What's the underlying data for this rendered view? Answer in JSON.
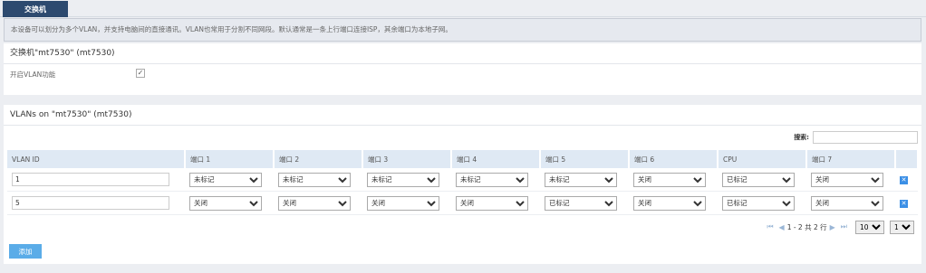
{
  "tab": {
    "label": "交换机"
  },
  "info_text": "本设备可以划分为多个VLAN，并支持电脑间的直接通讯。VLAN也常用于分割不同网段。默认通常是一条上行端口连接ISP，其余端口为本地子网。",
  "switch_section": {
    "title": "交换机\"mt7530\" (mt7530)",
    "enable_vlan_label": "开启VLAN功能",
    "enable_vlan_checked": true,
    "check_glyph": "✓"
  },
  "vlans_section": {
    "title": "VLANs on \"mt7530\" (mt7530)",
    "search_label": "搜索:",
    "search_value": "",
    "columns": [
      "VLAN ID",
      "端口 1",
      "端口 2",
      "端口 3",
      "端口 4",
      "端口 5",
      "端口 6",
      "CPU",
      "端口 7"
    ],
    "rows": [
      {
        "vlan_id": "1",
        "ports": [
          "未标记",
          "未标记",
          "未标记",
          "未标记",
          "未标记",
          "关闭",
          "已标记",
          "关闭"
        ]
      },
      {
        "vlan_id": "5",
        "ports": [
          "关闭",
          "关闭",
          "关闭",
          "关闭",
          "已标记",
          "关闭",
          "已标记",
          "关闭"
        ]
      }
    ],
    "delete_glyph": "✕"
  },
  "pager": {
    "first_icon": "⏮",
    "prev_icon": "◀",
    "range_text": "1 - 2 共 2 行",
    "next_icon": "▶",
    "last_icon": "⏭",
    "page_size": "10",
    "page": "1"
  },
  "add_button": {
    "label": "添加"
  },
  "colors": {
    "tab_bg": "#2d4a6f",
    "header_bg": "#dfe9f4",
    "button_blue": "#5aace8",
    "delete_blue": "#3b8fe6"
  }
}
